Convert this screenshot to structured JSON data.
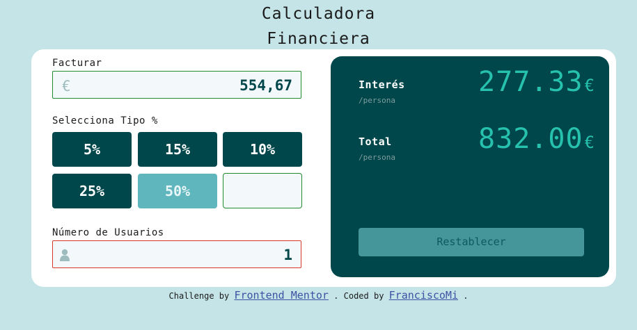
{
  "header": {
    "title_line1": "Calculadora",
    "title_line2": "Financiera"
  },
  "bill": {
    "label": "Facturar",
    "currency_icon": "€",
    "value": "554,67"
  },
  "tip": {
    "label": "Selecciona Tipo %",
    "options": [
      "5%",
      "15%",
      "10%",
      "25%",
      "50%"
    ],
    "active": "50%",
    "custom_value": ""
  },
  "people": {
    "label": "Número de Usuarios",
    "icon": "person-icon",
    "value": "1"
  },
  "results": {
    "interest": {
      "label": "Interés",
      "sub": "/persona",
      "amount": "277.33",
      "currency": "€"
    },
    "total": {
      "label": "Total",
      "sub": "/persona",
      "amount": "832.00",
      "currency": "€"
    },
    "reset_label": "Restablecer"
  },
  "footer": {
    "challenge_by": "Challenge by",
    "fm_link": "Frontend Mentor",
    "coded_by": ". Coded by",
    "author_link": "FranciscoMi",
    "end": "."
  },
  "colors": {
    "background": "#c5e4e7",
    "dark_cyan": "#00474b",
    "strong_cyan": "#26c2ae",
    "active_tip": "#5fb6bd",
    "error_border": "#d9362a",
    "focus_border": "#1f8a2e"
  }
}
